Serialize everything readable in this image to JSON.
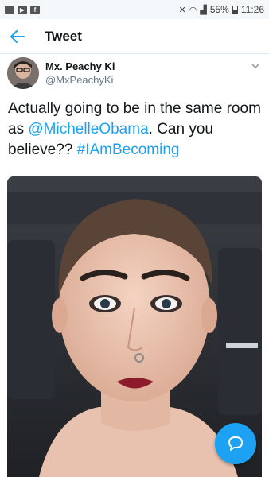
{
  "status_bar": {
    "battery": "55%",
    "time": "11:26"
  },
  "app_bar": {
    "title": "Tweet"
  },
  "tweet": {
    "display_name": "Mx. Peachy Ki",
    "handle": "@MxPeachyKi",
    "text_part1": "Actually going to be in the same room as ",
    "mention": "@MichelleObama",
    "text_part2": ". Can you believe?? ",
    "hashtag": "#IAmBecoming"
  },
  "colors": {
    "accent": "#1da1f2",
    "text": "#14171a",
    "secondary_text": "#657786"
  },
  "icons": {
    "back": "arrow-left-icon",
    "caret": "chevron-down-icon",
    "fab": "compose-reply-icon"
  }
}
